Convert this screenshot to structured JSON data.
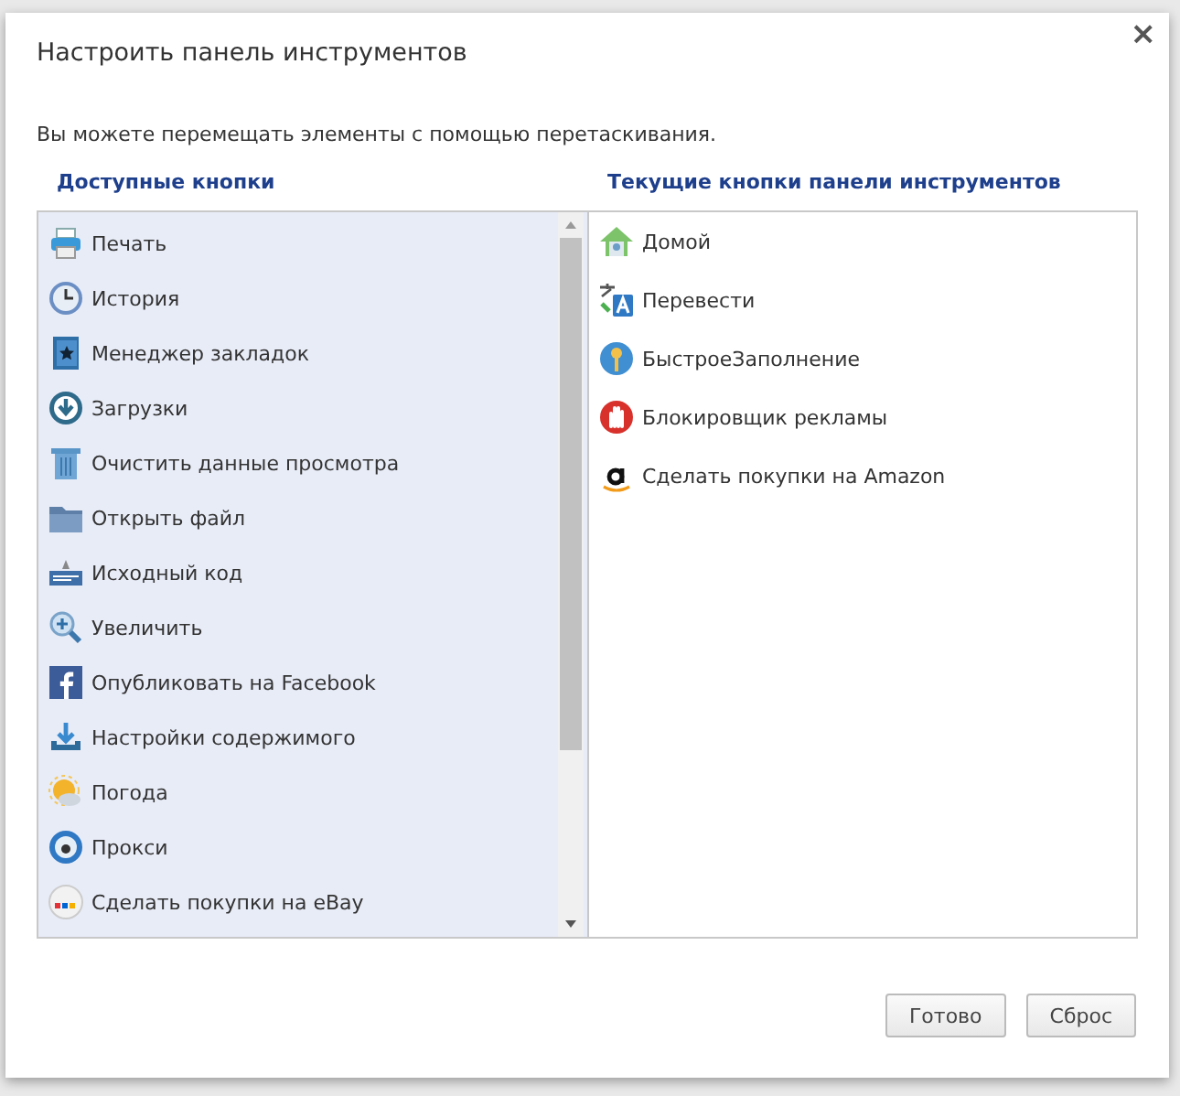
{
  "dialog": {
    "title": "Настроить панель инструментов",
    "close": "×",
    "hint": "Вы можете перемещать элементы с помощью перетаскивания."
  },
  "available": {
    "heading": "Доступные кнопки",
    "items": [
      {
        "label": "Печать"
      },
      {
        "label": "История"
      },
      {
        "label": "Менеджер закладок"
      },
      {
        "label": "Загрузки"
      },
      {
        "label": "Очистить данные просмотра"
      },
      {
        "label": "Открыть файл"
      },
      {
        "label": "Исходный код"
      },
      {
        "label": "Увеличить"
      },
      {
        "label": "Опубликовать на Facebook"
      },
      {
        "label": "Настройки содержимого"
      },
      {
        "label": "Погода"
      },
      {
        "label": "Прокси"
      },
      {
        "label": "Сделать покупки на eBay"
      }
    ]
  },
  "current": {
    "heading": "Текущие кнопки панели инструментов",
    "items": [
      {
        "label": "Домой"
      },
      {
        "label": "Перевести"
      },
      {
        "label": "БыстроеЗаполнение"
      },
      {
        "label": "Блокировщик рекламы"
      },
      {
        "label": "Сделать покупки на Amazon"
      }
    ]
  },
  "buttons": [
    "Готово",
    "Сброс"
  ]
}
